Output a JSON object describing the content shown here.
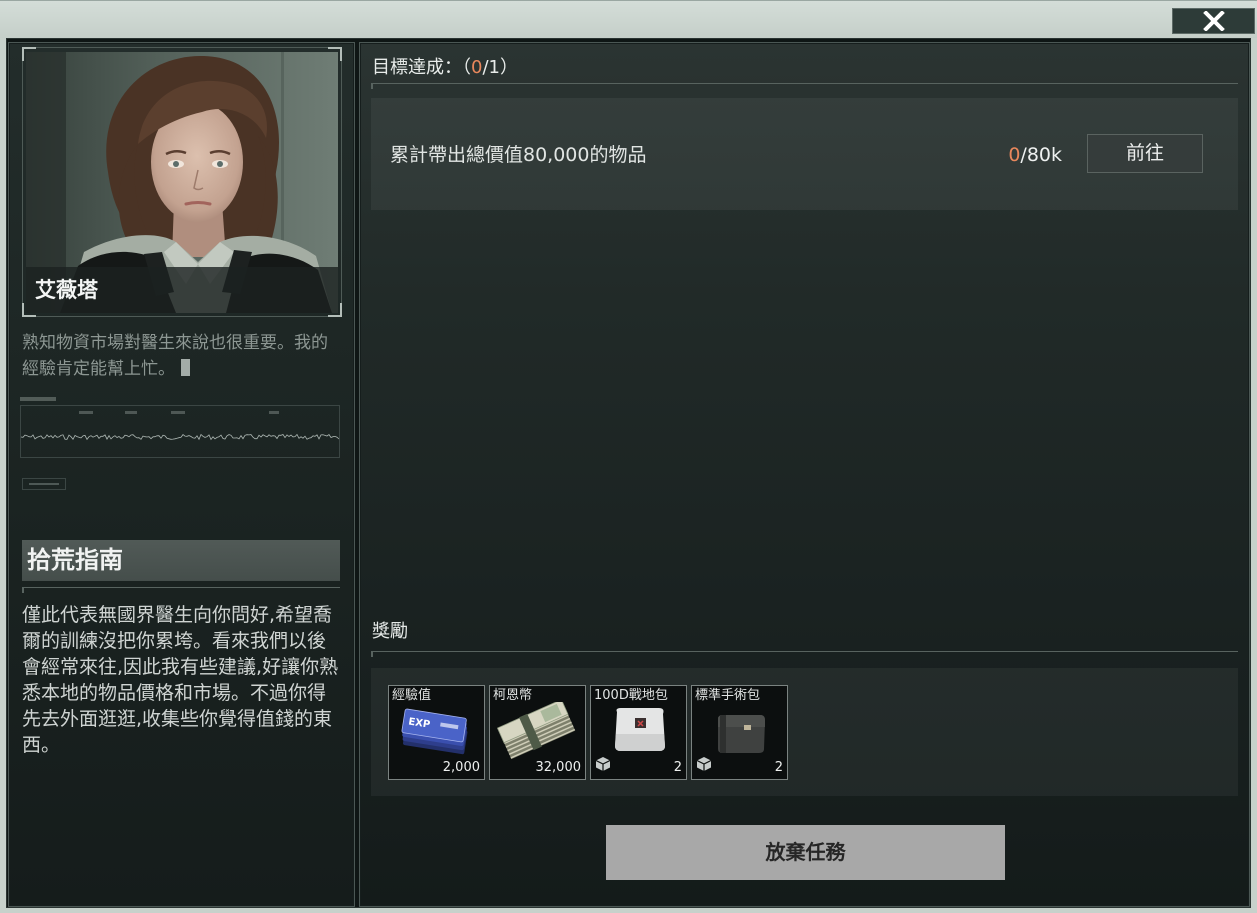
{
  "window": {
    "close_icon": "close-icon"
  },
  "character": {
    "name": "艾薇塔",
    "quote": "熟知物資市場對醫生來說也很重要。我的經驗肯定能幫上忙。"
  },
  "guide": {
    "title": "拾荒指南",
    "body": "僅此代表無國界醫生向你問好,希望喬爾的訓練沒把你累垮。看來我們以後會經常來往,因此我有些建議,好讓你熟悉本地的物品價格和市場。不過你得先去外面逛逛,收集些你覺得值錢的東西。"
  },
  "objectives": {
    "label": "目標達成：",
    "open": "（",
    "done": "0",
    "separator": "/",
    "total": "1",
    "close": "）",
    "items": [
      {
        "text": "累計帶出總價值80,000的物品",
        "current": "0",
        "separator": "/",
        "target": "80k",
        "button": "前往"
      }
    ]
  },
  "rewards": {
    "label": "獎勵",
    "items": [
      {
        "name": "經驗值",
        "quantity": "2,000",
        "icon": "exp-tickets-icon",
        "icon_text": "EXP"
      },
      {
        "name": "柯恩幣",
        "quantity": "32,000",
        "icon": "banknote-stack-icon"
      },
      {
        "name": "100D戰地包",
        "quantity": "2",
        "icon": "field-medkit-bag-icon",
        "badge_icon": "box-icon"
      },
      {
        "name": "標準手術包",
        "quantity": "2",
        "icon": "surgical-kit-icon",
        "badge_icon": "box-icon"
      }
    ]
  },
  "actions": {
    "abandon": "放棄任務"
  },
  "colors": {
    "progress_accent": "#e8875c",
    "panel_background": "#1c2524",
    "frame": "#c7d1cb",
    "abandon_button": "#a8a8a8"
  }
}
